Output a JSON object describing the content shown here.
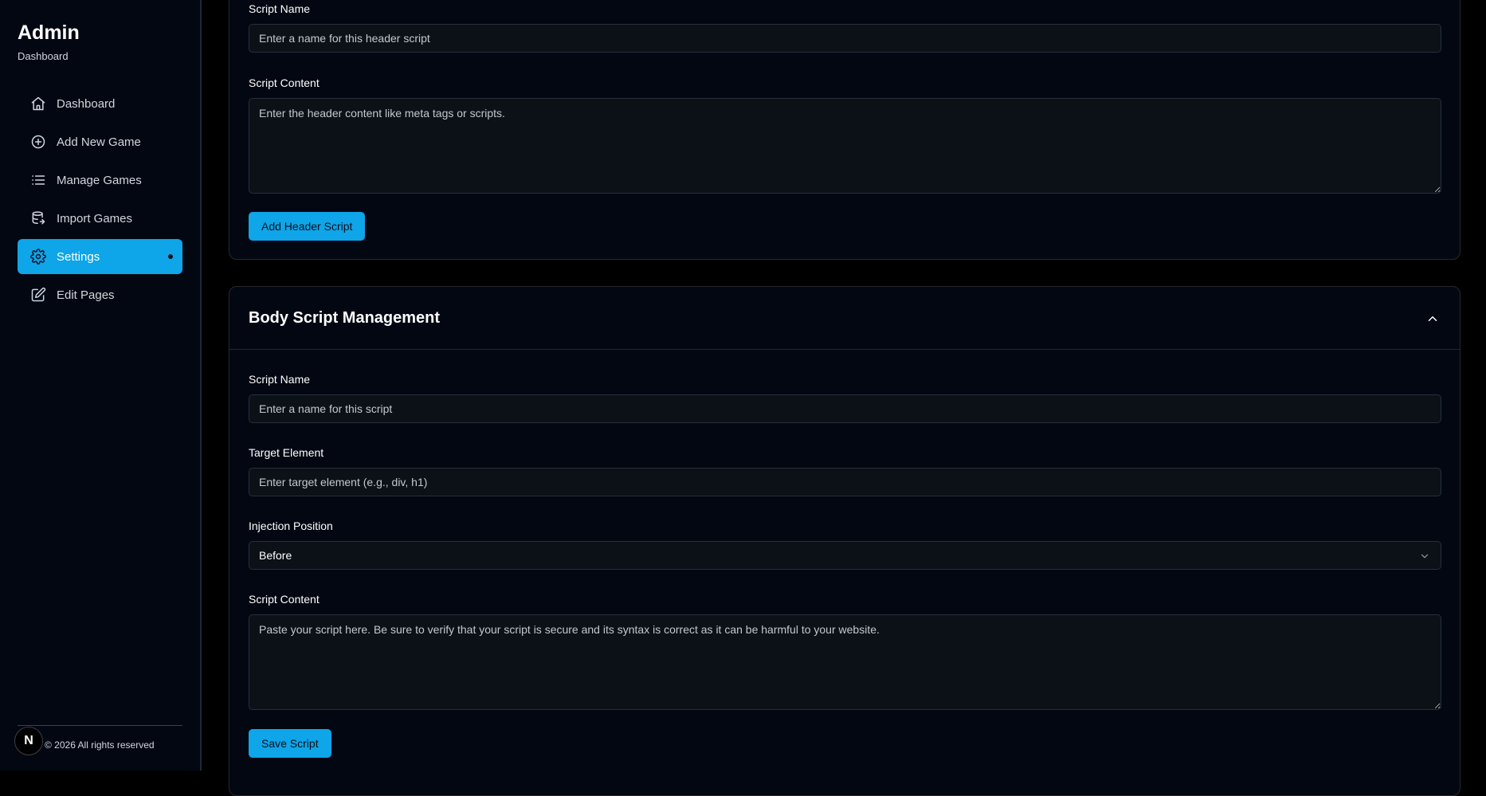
{
  "sidebar": {
    "title": "Admin",
    "subtitle": "Dashboard",
    "items": [
      {
        "label": "Dashboard",
        "icon": "home-icon"
      },
      {
        "label": "Add New Game",
        "icon": "plus-circle-icon"
      },
      {
        "label": "Manage Games",
        "icon": "list-icon"
      },
      {
        "label": "Import Games",
        "icon": "database-import-icon"
      },
      {
        "label": "Settings",
        "icon": "gear-icon",
        "active": true
      },
      {
        "label": "Edit Pages",
        "icon": "edit-icon"
      }
    ],
    "footer": {
      "logo_letter": "N",
      "text": "© 2026 All rights reserved"
    }
  },
  "header_script": {
    "script_name_label": "Script Name",
    "script_name_placeholder": "Enter a name for this header script",
    "script_content_label": "Script Content",
    "script_content_placeholder": "Enter the header content like meta tags or scripts.",
    "button_label": "Add Header Script"
  },
  "body_script": {
    "title": "Body Script Management",
    "script_name_label": "Script Name",
    "script_name_placeholder": "Enter a name for this script",
    "target_element_label": "Target Element",
    "target_element_placeholder": "Enter target element (e.g., div, h1)",
    "injection_position_label": "Injection Position",
    "injection_position_value": "Before",
    "script_content_label": "Script Content",
    "script_content_placeholder": "Paste your script here. Be sure to verify that your script is secure and its syntax is correct as it can be harmful to your website.",
    "button_label": "Save Script"
  },
  "colors": {
    "accent": "#0ea5e9",
    "sidebar_bg": "#030712",
    "card_bg": "#030712",
    "input_bg": "#0b1117"
  }
}
